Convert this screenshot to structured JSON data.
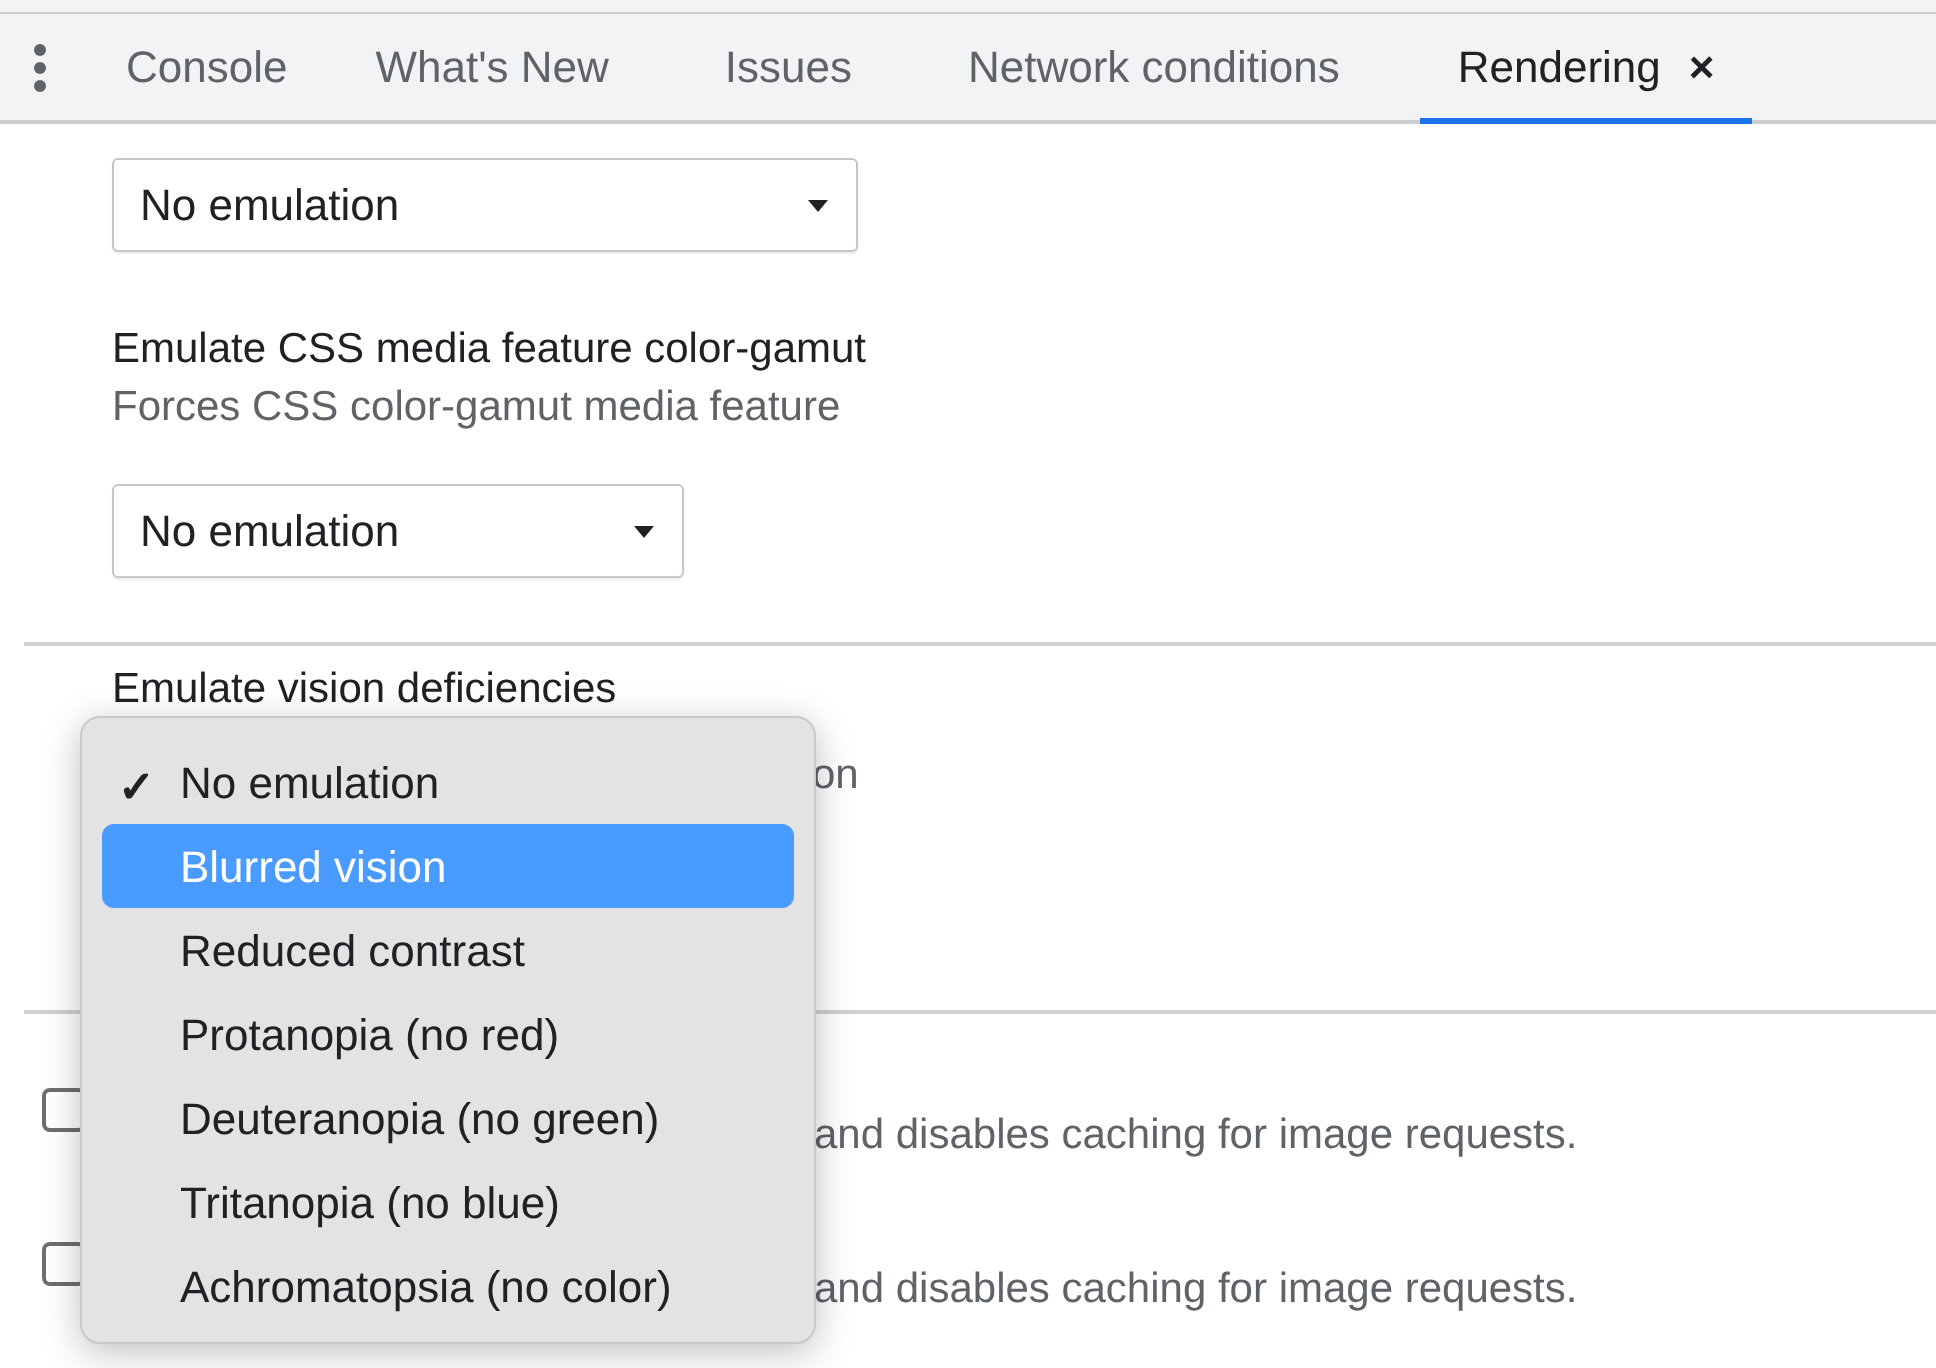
{
  "tabs": [
    {
      "label": "Console",
      "selected": false
    },
    {
      "label": "What's New",
      "selected": false
    },
    {
      "label": "Issues",
      "selected": false
    },
    {
      "label": "Network conditions",
      "selected": false
    },
    {
      "label": "Rendering",
      "selected": true,
      "close": "×"
    }
  ],
  "media_select": {
    "value": "No emulation"
  },
  "color_gamut": {
    "title": "Emulate CSS media feature color-gamut",
    "description": "Forces CSS color-gamut media feature",
    "select": {
      "value": "No emulation"
    }
  },
  "vision": {
    "title": "Emulate vision deficiencies",
    "description_fragment": "on"
  },
  "image_options": [
    {
      "checked": false,
      "description_fragment": "and disables caching for image requests."
    },
    {
      "checked": false,
      "description_fragment": "and disables caching for image requests."
    }
  ],
  "menu": {
    "check_mark": "✓",
    "items": [
      {
        "label": "No emulation",
        "checked": true,
        "selected": false
      },
      {
        "label": "Blurred vision",
        "checked": false,
        "selected": true
      },
      {
        "label": "Reduced contrast",
        "checked": false,
        "selected": false
      },
      {
        "label": "Protanopia (no red)",
        "checked": false,
        "selected": false
      },
      {
        "label": "Deuteranopia (no green)",
        "checked": false,
        "selected": false
      },
      {
        "label": "Tritanopia (no blue)",
        "checked": false,
        "selected": false
      },
      {
        "label": "Achromatopsia (no color)",
        "checked": false,
        "selected": false
      }
    ]
  }
}
